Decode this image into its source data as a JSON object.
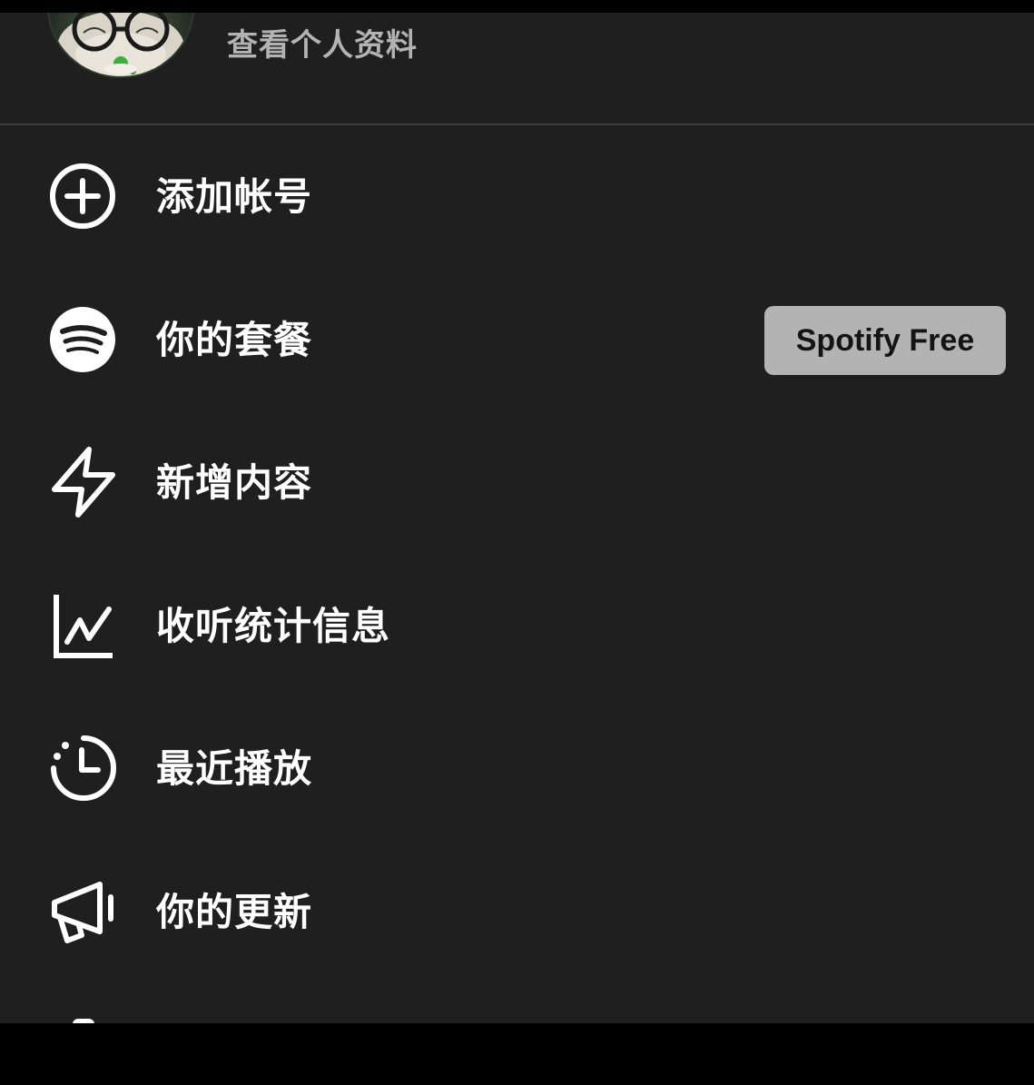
{
  "profile": {
    "view_profile_label": "查看个人资料"
  },
  "menu": {
    "items": [
      {
        "label": "添加帐号",
        "icon": "add-circle-icon"
      },
      {
        "label": "你的套餐",
        "icon": "spotify-logo-icon",
        "badge": "Spotify Free"
      },
      {
        "label": "新增内容",
        "icon": "lightning-icon"
      },
      {
        "label": "收听统计信息",
        "icon": "stats-chart-icon"
      },
      {
        "label": "最近播放",
        "icon": "recent-clock-icon"
      },
      {
        "label": "你的更新",
        "icon": "megaphone-icon"
      }
    ]
  },
  "colors": {
    "panel_background": "#1f1f1f",
    "text_primary": "#ffffff",
    "text_secondary": "#b3b3b3",
    "badge_background": "#b3b3b3",
    "badge_text": "#141414",
    "divider": "#3e3e3e"
  }
}
